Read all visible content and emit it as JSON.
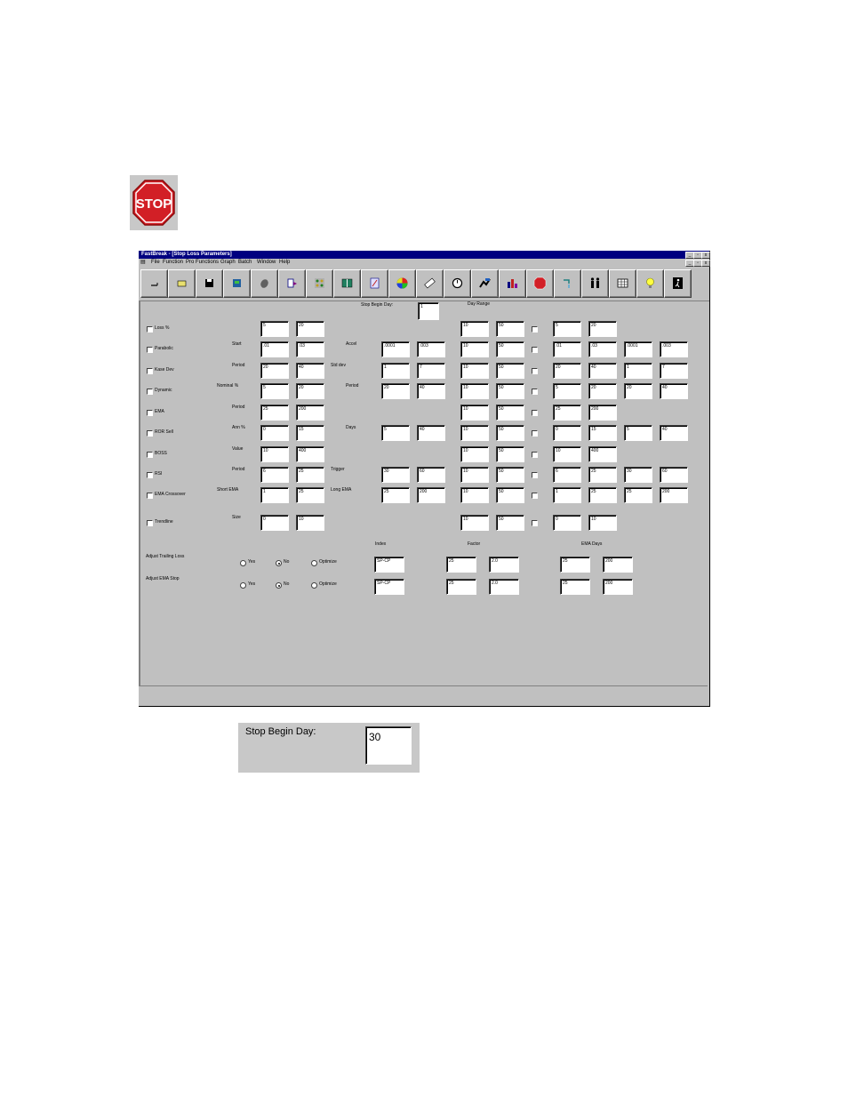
{
  "window": {
    "title": "FastBreak - [Stop Loss Parameters]",
    "controls": [
      "_",
      "̅̅",
      "x"
    ],
    "menu": [
      "File",
      "Function",
      "Pro Functions",
      "Graph",
      "Batch",
      "Window",
      "Help"
    ]
  },
  "toolbar": {
    "icons": [
      "dash-icon",
      "open-folder-icon",
      "save-disk-icon",
      "notebook-icon",
      "eraser-icon",
      "export-icon",
      "grid-dots-icon",
      "book-icon",
      "sort-az-icon",
      "color-wheel-icon",
      "ruler-icon",
      "watch-icon",
      "runner-icon",
      "bar-chart-icon",
      "stop-sign-icon",
      "faucet-icon",
      "people-icon",
      "calendar-icon",
      "lightbulb-icon",
      "exit-door-icon"
    ],
    "stop_label": "STOP"
  },
  "header": {
    "stop_begin_label": "Stop Begin Day:",
    "stop_begin_value": "1",
    "day_range_label": "Day Range"
  },
  "rows": [
    {
      "name": "Loss %",
      "sublabel1": "",
      "a": "5",
      "b": "20",
      "sublabel2": "",
      "c": "",
      "d": "",
      "r1": "10",
      "r2": "50",
      "e": "5",
      "f": "20",
      "g": "",
      "h": ""
    },
    {
      "name": "Parabolic",
      "sublabel1": "Start",
      "a": ".01",
      "b": ".03",
      "sublabel2": "Accel",
      "c": ".0001",
      "d": ".003",
      "r1": "10",
      "r2": "50",
      "e": ".01",
      "f": ".03",
      "g": ".0001",
      "h": ".003"
    },
    {
      "name": "Kase Dev",
      "sublabel1": "Period",
      "a": "20",
      "b": "40",
      "sublabel2": "Std dev",
      "c": "1",
      "d": "7",
      "r1": "10",
      "r2": "50",
      "e": "20",
      "f": "40",
      "g": "1",
      "h": "7"
    },
    {
      "name": "Dynamic",
      "sublabel1": "Nominal %",
      "a": "5",
      "b": "20",
      "sublabel2": "Period",
      "c": "20",
      "d": "40",
      "r1": "10",
      "r2": "50",
      "e": "5",
      "f": "20",
      "g": "20",
      "h": "40"
    },
    {
      "name": "EMA",
      "sublabel1": "Period",
      "a": "25",
      "b": "200",
      "sublabel2": "",
      "c": "",
      "d": "",
      "r1": "10",
      "r2": "50",
      "e": "25",
      "f": "200",
      "g": "",
      "h": ""
    },
    {
      "name": "ROR Sell",
      "sublabel1": "Ann %",
      "a": "0",
      "b": "15",
      "sublabel2": "Days",
      "c": "5",
      "d": "40",
      "r1": "10",
      "r2": "50",
      "e": "0",
      "f": "15",
      "g": "5",
      "h": "40"
    },
    {
      "name": "BOSS",
      "sublabel1": "Value",
      "a": "10",
      "b": "400",
      "sublabel2": "",
      "c": "",
      "d": "",
      "r1": "10",
      "r2": "50",
      "e": "10",
      "f": "400",
      "g": "",
      "h": ""
    },
    {
      "name": "RSI",
      "sublabel1": "Period",
      "a": "6",
      "b": "25",
      "sublabel2": "Trigger",
      "c": "30",
      "d": "60",
      "r1": "10",
      "r2": "50",
      "e": "6",
      "f": "25",
      "g": "30",
      "h": "60"
    },
    {
      "name": "EMA Crossover",
      "sublabel1": "Short EMA",
      "a": "1",
      "b": "25",
      "sublabel2": "Long EMA",
      "c": "25",
      "d": "200",
      "r1": "10",
      "r2": "50",
      "e": "1",
      "f": "25",
      "g": "25",
      "h": "200"
    },
    {
      "name": "Trendline",
      "sublabel1": "Size",
      "a": "0",
      "b": "10",
      "sublabel2": "",
      "c": "",
      "d": "",
      "r1": "10",
      "r2": "50",
      "e": "0",
      "f": "10",
      "g": "",
      "h": ""
    }
  ],
  "adjust": {
    "index_label": "Index",
    "factor_label": "Factor",
    "ema_days_label": "EMA Days",
    "options": [
      "Yes",
      "No",
      "Optimize"
    ],
    "items": [
      {
        "label": "Adjust Trailing Loss",
        "selected": "No",
        "index": "SP-CP",
        "factor1": "25",
        "factor2": "2.0",
        "ema1": "25",
        "ema2": "200"
      },
      {
        "label": "Adjust EMA Stop",
        "selected": "No",
        "index": "SP-CP",
        "factor1": "25",
        "factor2": "2.0",
        "ema1": "25",
        "ema2": "200"
      }
    ]
  },
  "zoom_panel": {
    "label": "Stop Begin Day:",
    "value": "30"
  },
  "colors": {
    "titlebar": "#000080",
    "face": "#c0c0c0",
    "stop_red": "#d21f26"
  }
}
